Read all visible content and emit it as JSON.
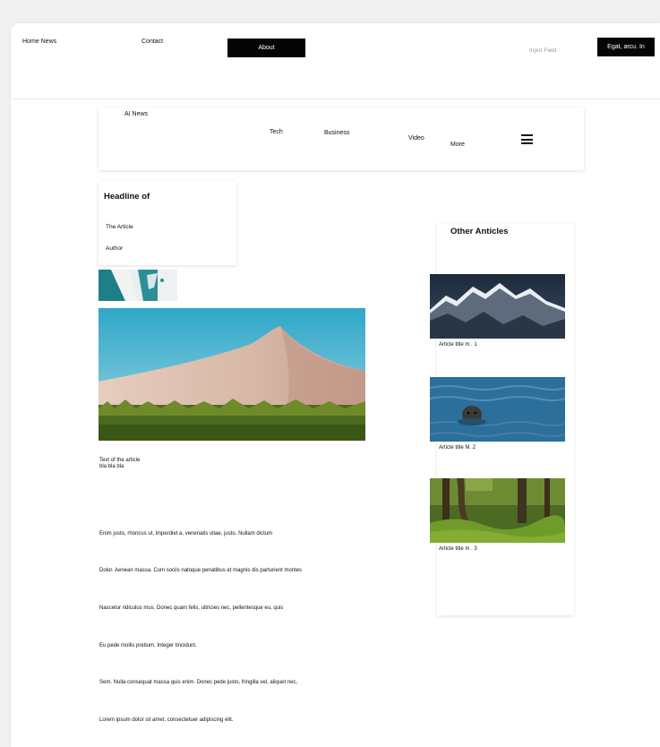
{
  "topnav": {
    "home_news": "Home News",
    "contact": "Contact",
    "about": "About",
    "input_placeholder": "Input Field",
    "action_button": "Egat, arcu. In"
  },
  "categories": {
    "brand": "AI News",
    "tech": "Tech",
    "business": "Business",
    "video": "Video",
    "more": "More"
  },
  "headline_card": {
    "headline": "Headline of",
    "sub": "The Article",
    "author": "Author"
  },
  "article": {
    "intro_line1": "Text of the article",
    "intro_line2": "bla bla bla",
    "paragraphs": [
      "Enim justo, rhoncus ut, imperdiet a, venenatis vitae, justo. Nullam dictum",
      "Dolor. Aenean massa. Cum sociis natoque penatibus et magnis dis parturient montes",
      "Nascetur ridiculus mus. Donec quam felis, ultricies nec, pellentesque eu, quis",
      "Eu pede mollis pretium. Integer tincidunt.",
      "Sem. Nulla consequat massa quis enim. Donec pede justo, fringilla vel, aliquet nec,",
      "Lorem ipsum dolor sit amet, consectetuer adipiscing elit."
    ]
  },
  "sidebar": {
    "title": "Other Anticles",
    "items": [
      {
        "title": "Article title m . 1"
      },
      {
        "title": "Article title M. 2"
      },
      {
        "title": "Article title m . 3"
      }
    ]
  }
}
